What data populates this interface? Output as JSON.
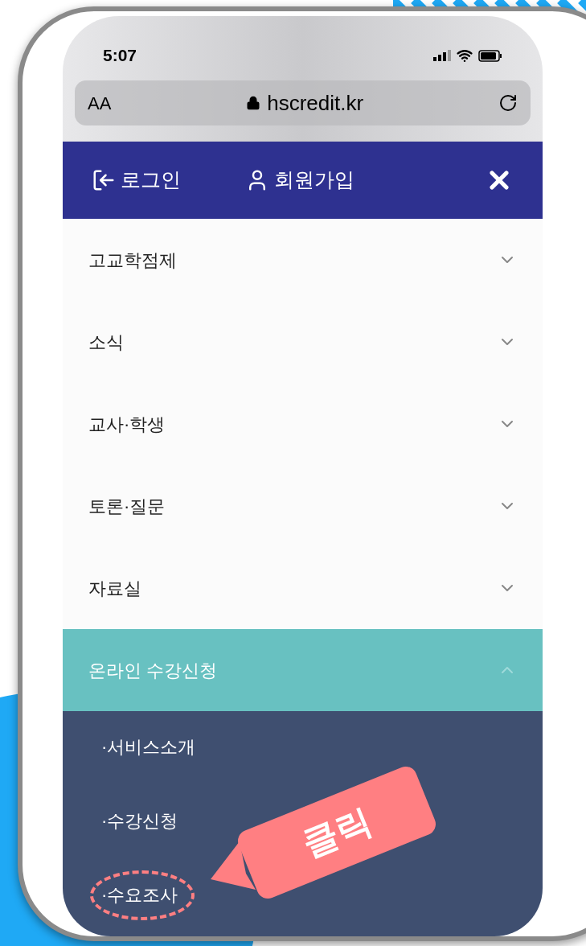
{
  "status_bar": {
    "time": "5:07"
  },
  "address_bar": {
    "text_size": "AA",
    "url": "hscredit.kr"
  },
  "nav_bar": {
    "login": "로그인",
    "signup": "회원가입"
  },
  "menu": [
    {
      "label": "고교학점제",
      "expanded": false
    },
    {
      "label": "소식",
      "expanded": false
    },
    {
      "label": "교사·학생",
      "expanded": false
    },
    {
      "label": "토론·질문",
      "expanded": false
    },
    {
      "label": "자료실",
      "expanded": false
    },
    {
      "label": "온라인 수강신청",
      "expanded": true,
      "children": [
        {
          "label": "·서비스소개",
          "highlighted": false
        },
        {
          "label": "·수강신청",
          "highlighted": false
        },
        {
          "label": "·수요조사",
          "highlighted": true
        }
      ]
    }
  ],
  "callout": {
    "text": "클릭"
  }
}
